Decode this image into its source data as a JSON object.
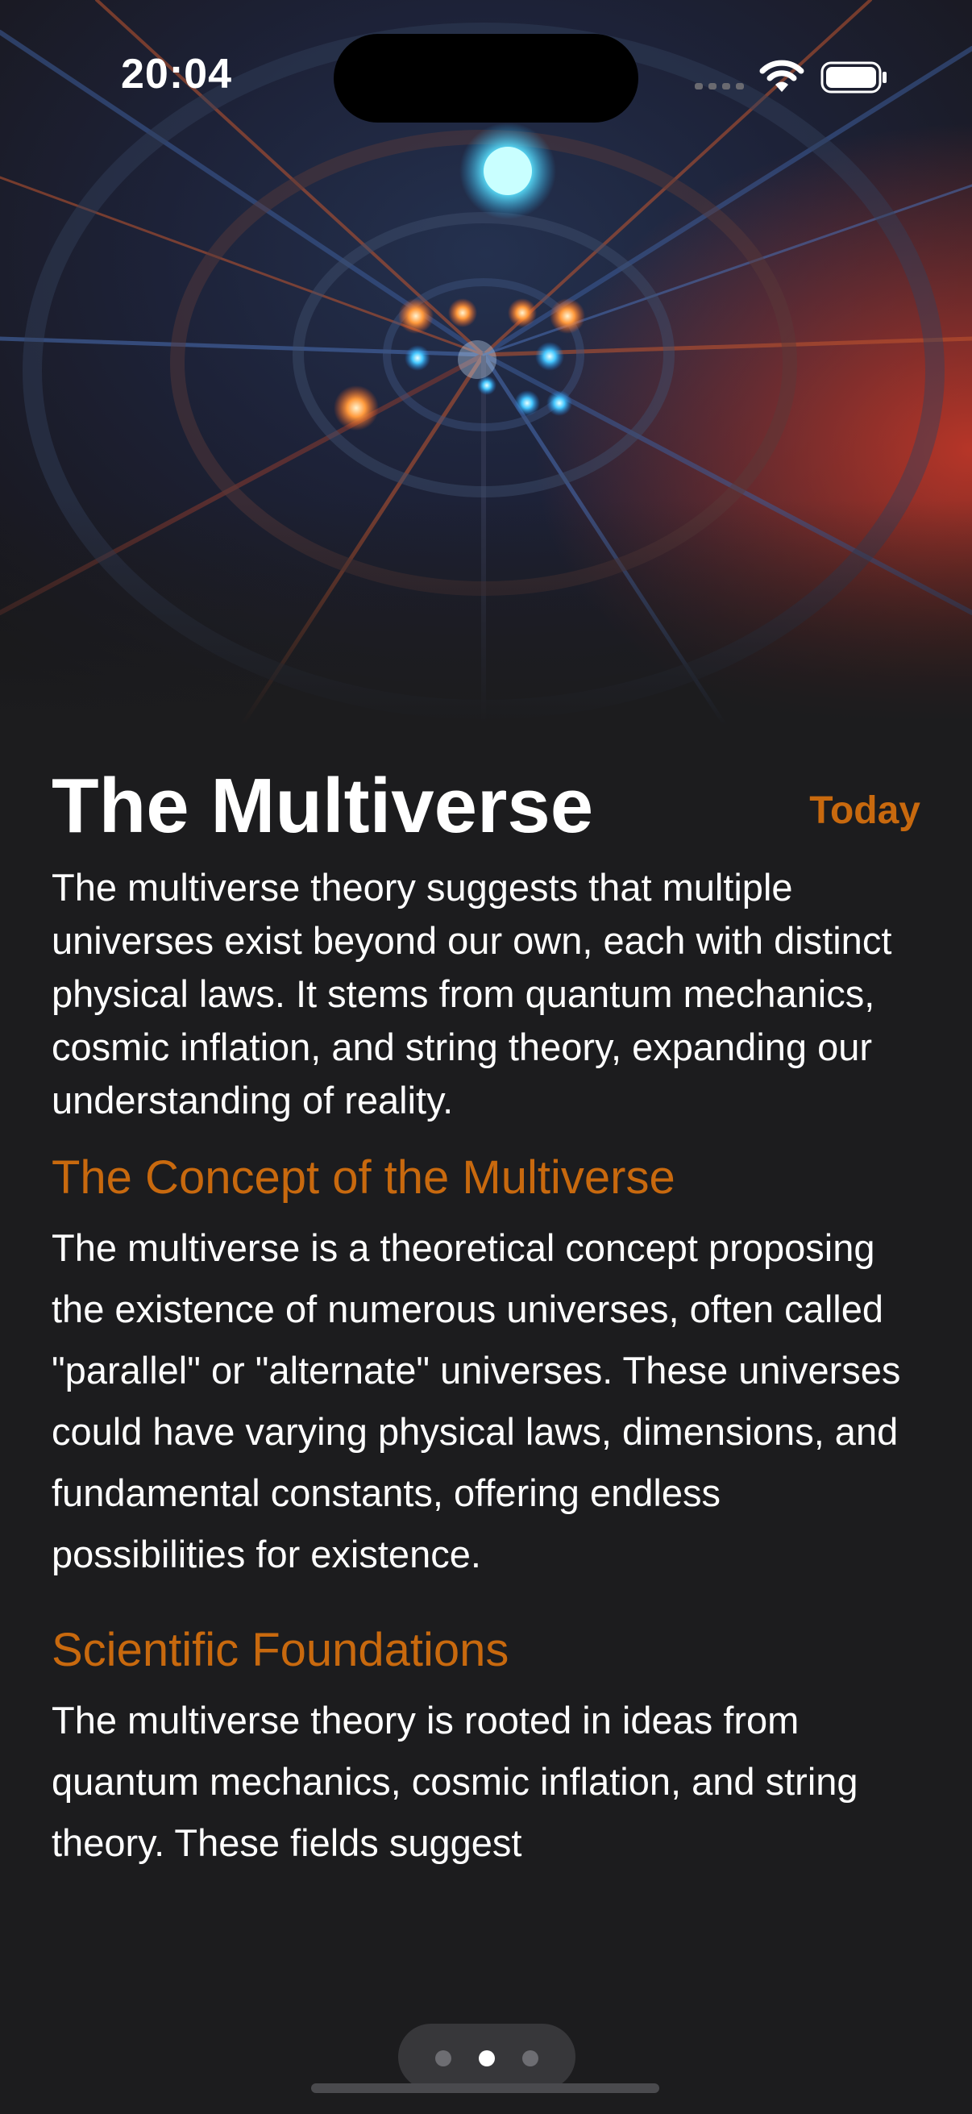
{
  "status_bar": {
    "time": "20:04",
    "icons": [
      "signal-icon",
      "wifi-icon",
      "battery-icon"
    ]
  },
  "hero": {
    "image": "multiverse-tunnel-image"
  },
  "article": {
    "title": "The Multiverse",
    "date_label": "Today",
    "intro": "The multiverse theory suggests that multiple universes exist beyond our own, each with distinct physical laws. It stems from quantum mechanics, cosmic inflation, and string theory, expanding our understanding of reality.",
    "sections": [
      {
        "heading": "The Concept of the Multiverse",
        "body": "The multiverse is a theoretical concept proposing the existence of numerous universes, often called \"parallel\" or \"alternate\" universes. These universes could have varying physical laws, dimensions, and fundamental constants, offering endless possibilities for existence."
      },
      {
        "heading": "Scientific Foundations",
        "body": "The multiverse theory is rooted in ideas from quantum mechanics, cosmic inflation, and string theory. These fields suggest"
      }
    ]
  },
  "pager": {
    "page_count": 3,
    "current_page": 2
  },
  "colors": {
    "background": "#1c1c1e",
    "accent": "#c8690e",
    "text": "#ffffff"
  }
}
